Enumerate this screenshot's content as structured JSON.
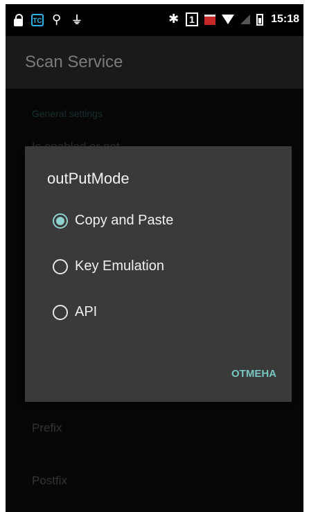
{
  "status_bar": {
    "tc_icon_text": "TC",
    "sim_slot": "1",
    "time": "15:18"
  },
  "app": {
    "title": "Scan Service"
  },
  "settings": {
    "section_header": "General settings",
    "items": [
      {
        "label": "Is enabled or not"
      },
      {
        "label": "Prefix"
      },
      {
        "label": "Postfix"
      }
    ]
  },
  "dialog": {
    "title": "outPutMode",
    "options": [
      {
        "label": "Copy and Paste",
        "selected": true
      },
      {
        "label": "Key Emulation",
        "selected": false
      },
      {
        "label": "API",
        "selected": false
      }
    ],
    "cancel_label": "ОТМЕНА",
    "accent_color": "#8fd1cc"
  }
}
